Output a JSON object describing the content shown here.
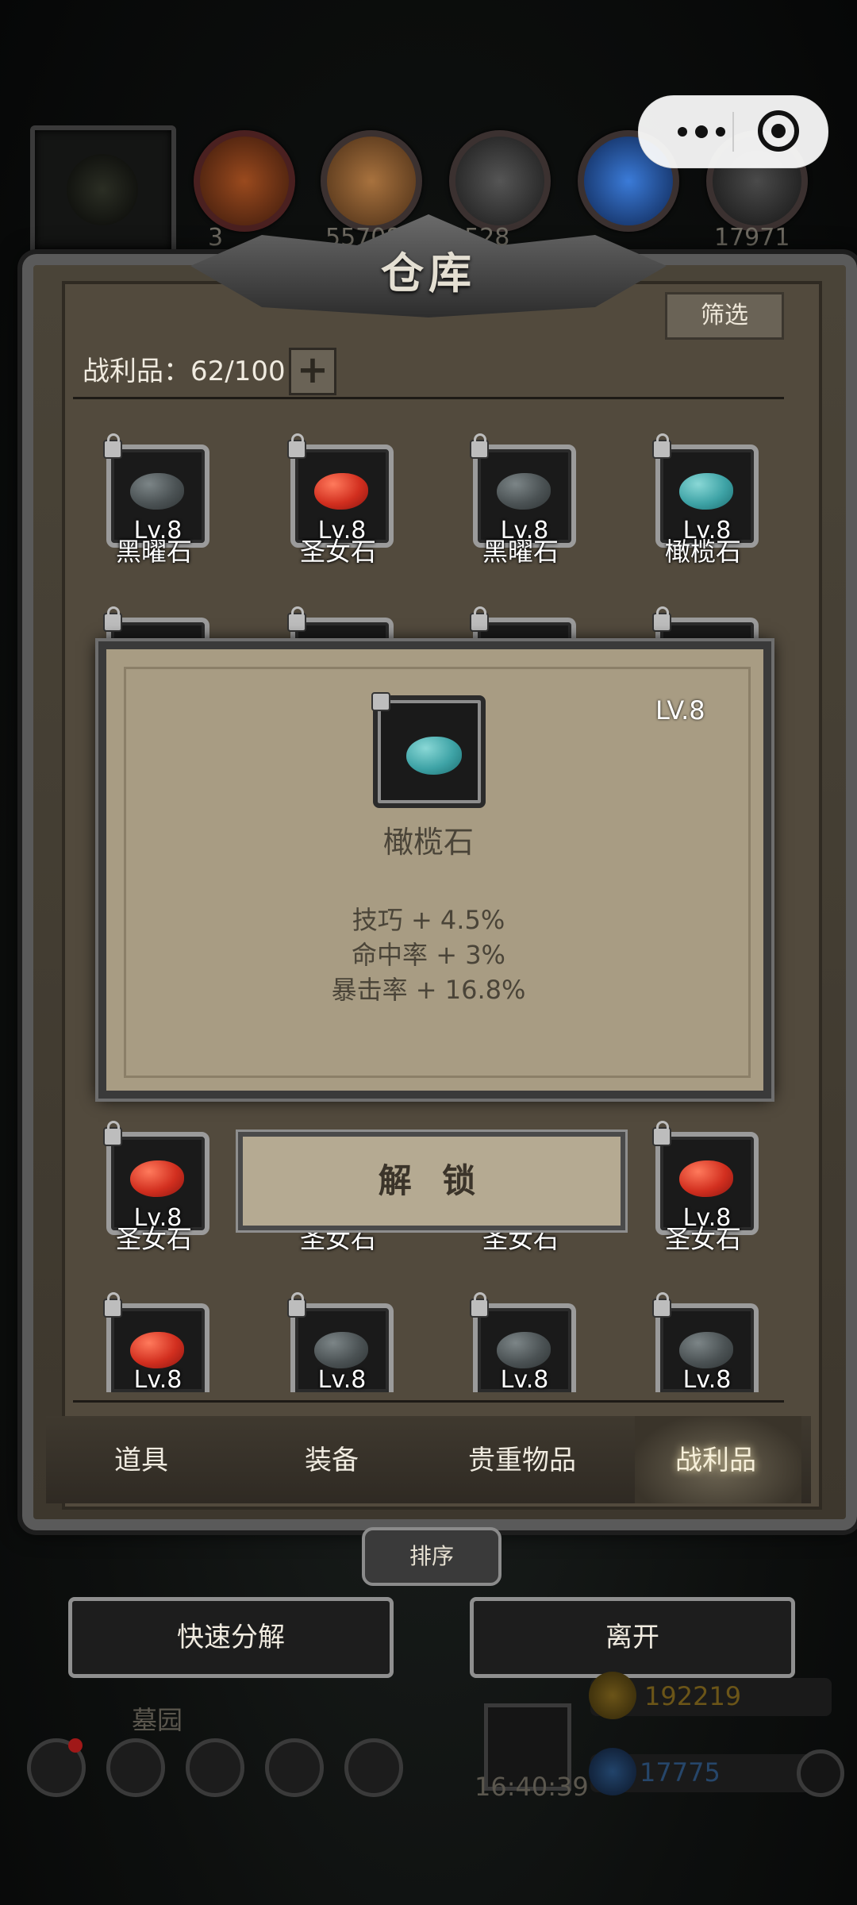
{
  "capsule": {
    "menu_icon": "more-dots-icon",
    "close_icon": "target-circle-icon"
  },
  "top_resources": {
    "values": [
      "3",
      "55708",
      "4528",
      "17971"
    ]
  },
  "warehouse": {
    "title": "仓库",
    "filter_label": "筛选",
    "loot_count": "战利品：62/100",
    "expand_icon": "plus-icon"
  },
  "items_row1": [
    {
      "level": "Lv.8",
      "name": "黑曜石",
      "gem": "obsidian"
    },
    {
      "level": "Lv.8",
      "name": "圣女石",
      "gem": "saint"
    },
    {
      "level": "Lv.8",
      "name": "黑曜石",
      "gem": "obsidian"
    },
    {
      "level": "Lv.8",
      "name": "橄榄石",
      "gem": "olive"
    }
  ],
  "items_row3": [
    {
      "level": "Lv.8",
      "name": "圣女石",
      "gem": "saint"
    },
    {
      "level": "",
      "name": "圣女石",
      "gem": "saint"
    },
    {
      "level": "",
      "name": "圣女石",
      "gem": "saint"
    },
    {
      "level": "Lv.8",
      "name": "圣女石",
      "gem": "saint"
    }
  ],
  "items_row4": [
    {
      "level": "Lv.8",
      "gem": "saint"
    },
    {
      "level": "Lv.8",
      "gem": "obsidian"
    },
    {
      "level": "Lv.8",
      "gem": "obsidian"
    },
    {
      "level": "Lv.8",
      "gem": "obsidian"
    }
  ],
  "popup": {
    "level": "LV.8",
    "name": "橄榄石",
    "stats": [
      "技巧 + 4.5%",
      "命中率 + 3%",
      "暴击率 + 16.8%"
    ],
    "unlock_label": "解 锁"
  },
  "tabs": [
    {
      "label": "道具",
      "active": false
    },
    {
      "label": "装备",
      "active": false
    },
    {
      "label": "贵重物品",
      "active": false
    },
    {
      "label": "战利品",
      "active": true
    }
  ],
  "sort_label": "排序",
  "buttons": {
    "quick_decompose": "快速分解",
    "leave": "离开"
  },
  "hud": {
    "location": "墓园",
    "timer": "16:40:39",
    "gold": "192219",
    "gems": "17775"
  },
  "colors": {
    "panel": "#524a3d",
    "popup": "#a89c83",
    "accent_gold": "#c9a227"
  }
}
